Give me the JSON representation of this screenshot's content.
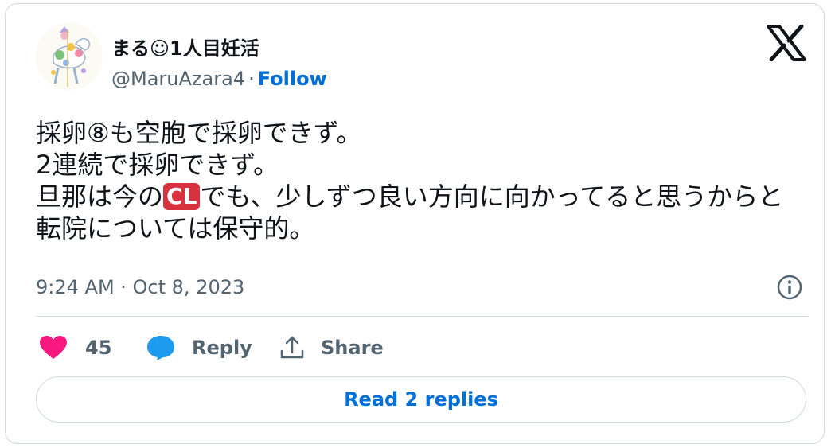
{
  "author": {
    "name": "まる☺︎1人目妊活",
    "handle": "@MaruAzara4",
    "separator": "·",
    "follow_label": "Follow"
  },
  "tweet": {
    "text_before_badge": "採卵⑧も空胞で採卵できず。\n2連続で採卵できず。\n旦那は今の",
    "badge": "CL",
    "text_after_badge": "でも、少しずつ良い方向に向かってると思うからと転院については保守的。",
    "timestamp": "9:24 AM · Oct 8, 2023"
  },
  "actions": {
    "like_count": "45",
    "reply_label": "Reply",
    "share_label": "Share"
  },
  "read_replies_label": "Read 2 replies",
  "colors": {
    "like": "#f91880",
    "reply": "#1d9bf0",
    "link": "#006fd6",
    "muted": "#536471",
    "badge": "#d9323f"
  },
  "icons": [
    "avatar",
    "x-logo-icon",
    "info-icon",
    "heart-icon",
    "reply-bubble-icon",
    "share-icon"
  ]
}
